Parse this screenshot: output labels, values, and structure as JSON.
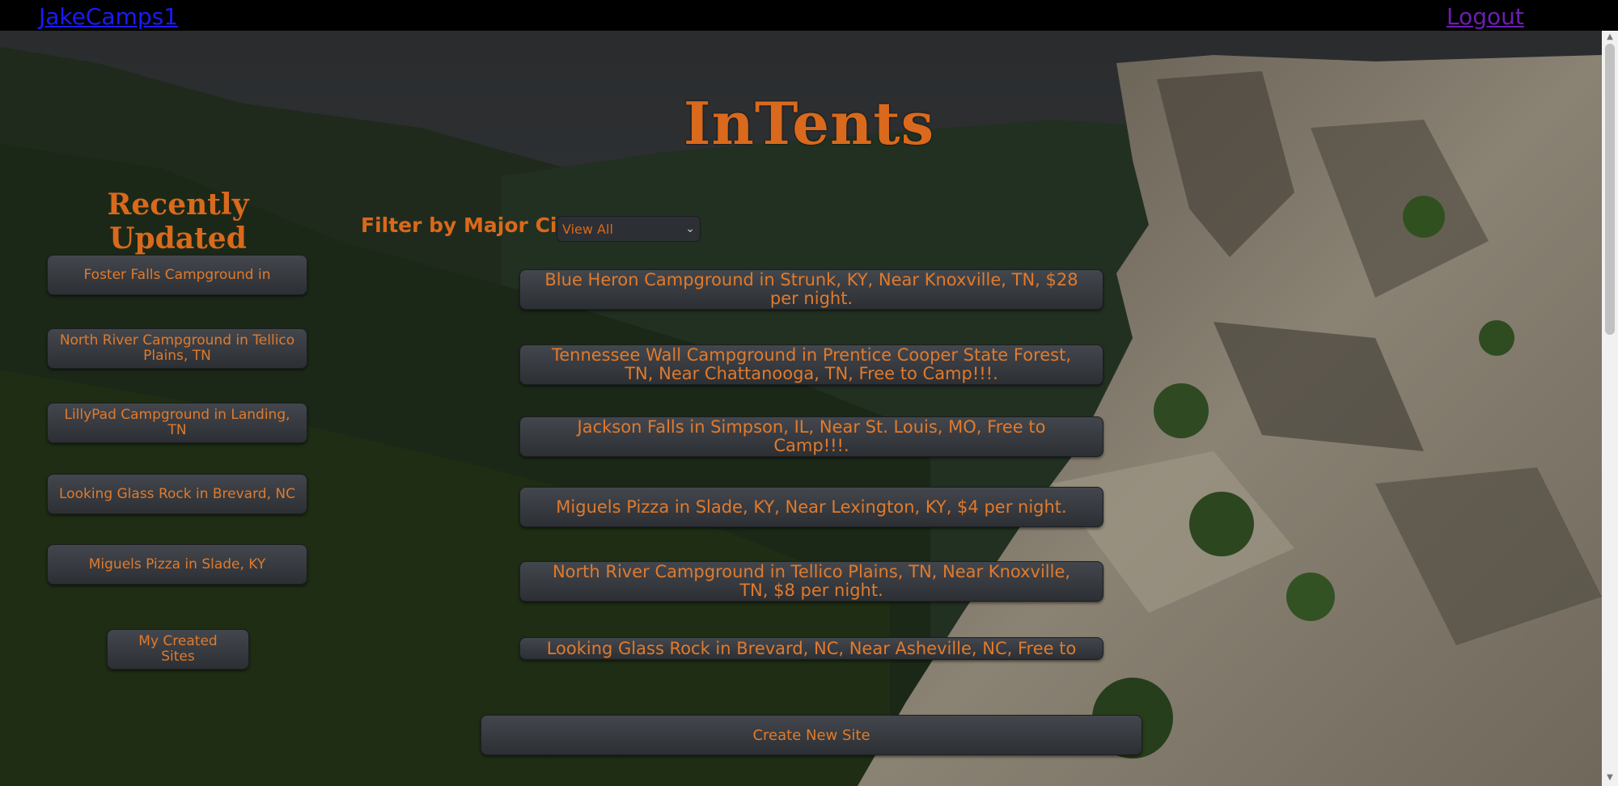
{
  "nav": {
    "user_label": "JakeCamps1",
    "logout_label": "Logout"
  },
  "app_title": "InTents",
  "recently_updated": {
    "heading": "Recently Updated",
    "items": [
      "Foster Falls Campground in",
      "North River Campground in Tellico Plains, TN",
      "LillyPad Campground in Landing, TN",
      "Looking Glass Rock in Brevard, NC",
      "Miguels Pizza in Slade, KY"
    ],
    "my_sites_label": "My Created Sites"
  },
  "filter": {
    "label": "Filter by Major City:",
    "selected": "View All"
  },
  "sites": [
    "Blue Heron Campground in Strunk, KY, Near Knoxville, TN, $28 per night.",
    "Tennessee Wall Campground in Prentice Cooper State Forest, TN, Near Chattanooga, TN, Free to Camp!!!.",
    "Jackson Falls in Simpson, IL, Near St. Louis, MO, Free to Camp!!!.",
    "Miguels Pizza in Slade, KY, Near Lexington, KY, $4 per night.",
    "North River Campground in Tellico Plains, TN, Near Knoxville, TN, $8 per night.",
    "Looking Glass Rock in Brevard, NC, Near Asheville, NC, Free to"
  ],
  "create_label": "Create New Site",
  "colors": {
    "accent": "#d9691c",
    "button": "#373a3f",
    "bar": "#000000"
  }
}
